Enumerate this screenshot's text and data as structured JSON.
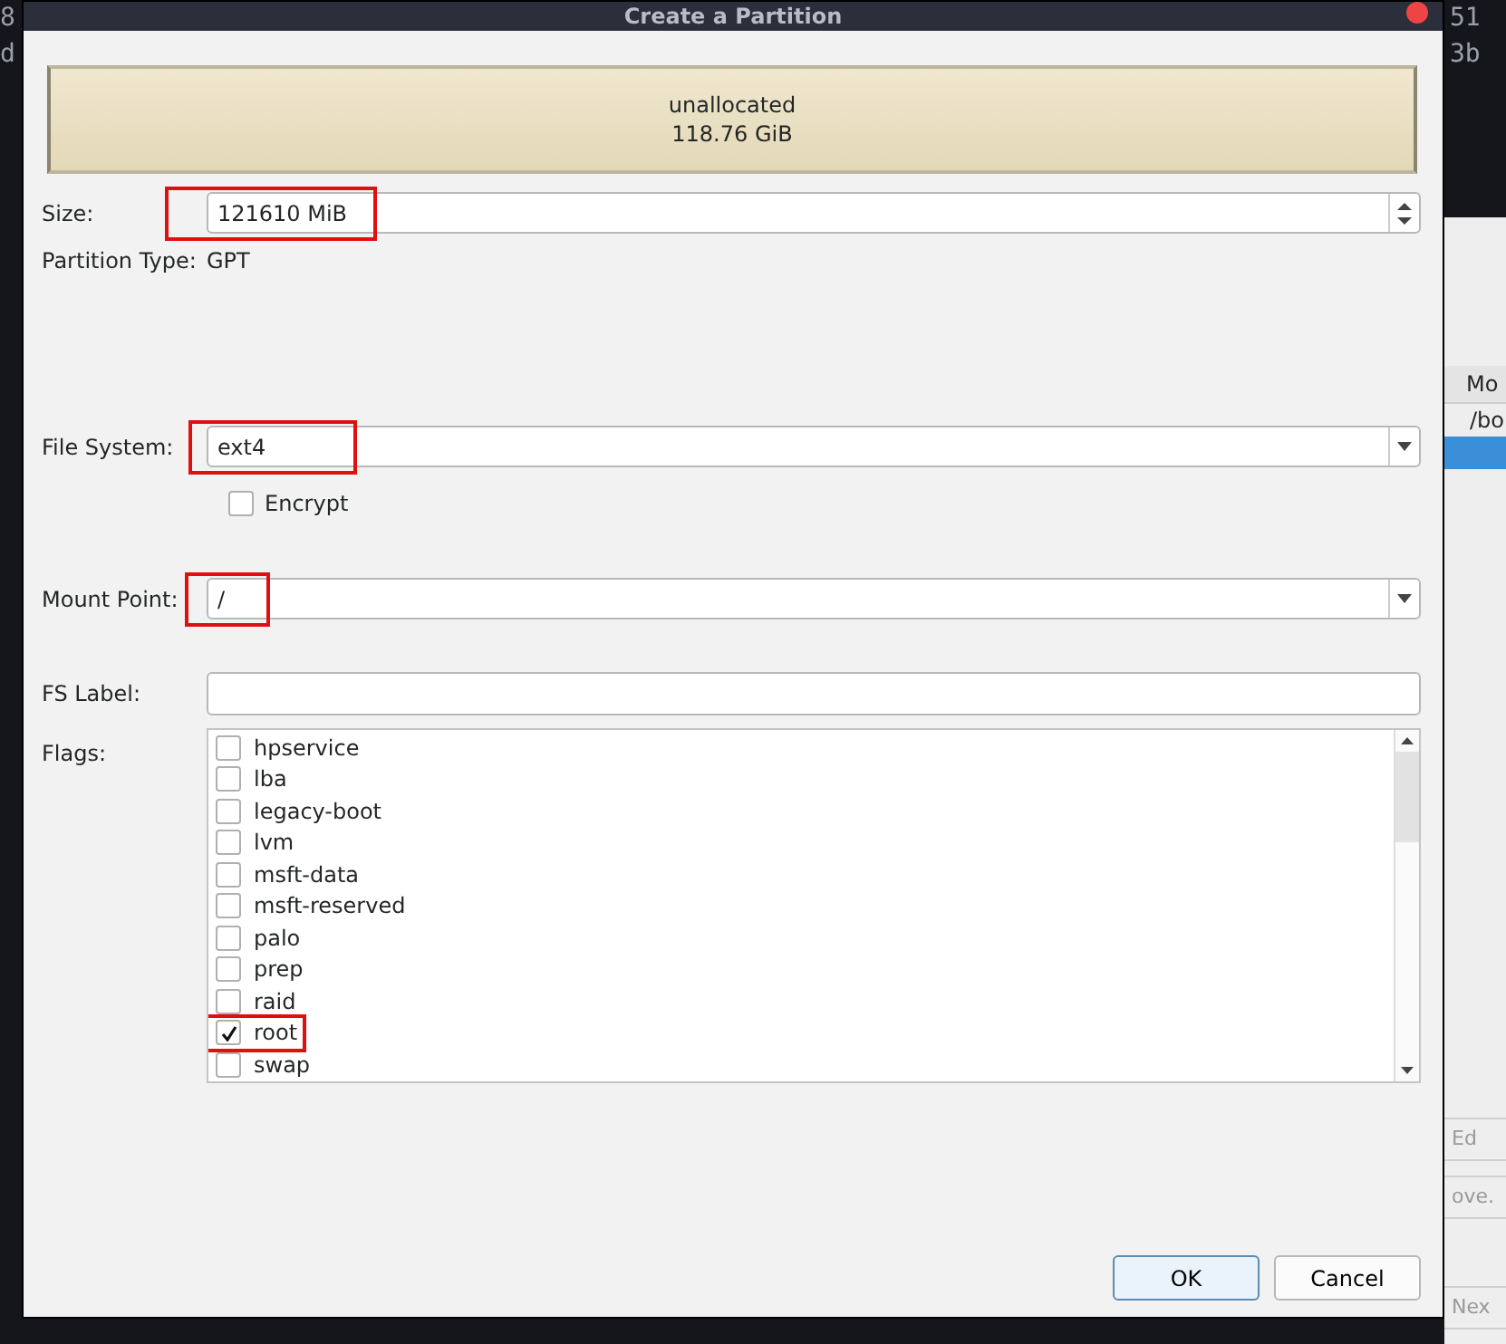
{
  "background_app": {
    "top_texts": [
      "51",
      "3b"
    ],
    "left_texts": [
      "8",
      "d"
    ],
    "table_header": "Mo",
    "table_rows": [
      {
        "text": "/bo",
        "selected": false
      },
      {
        "text": "",
        "selected": true
      }
    ],
    "buttons": [
      "Ed",
      "ove.",
      "Nex"
    ]
  },
  "window": {
    "title": "Create a Partition"
  },
  "partition_bar": {
    "label": "unallocated",
    "size": "118.76 GiB"
  },
  "size": {
    "label": "Size:",
    "value": "121610 MiB",
    "annotated": true
  },
  "partition_type": {
    "label": "Partition Type:",
    "value": "GPT"
  },
  "file_system": {
    "label": "File System:",
    "value": "ext4",
    "annotated": true
  },
  "encrypt": {
    "label": "Encrypt",
    "checked": false
  },
  "mount_point": {
    "label": "Mount Point:",
    "value": "/",
    "annotated": true
  },
  "fs_label": {
    "label": "FS Label:"
  },
  "flags": {
    "label": "Flags:",
    "items": [
      {
        "label": "hpservice",
        "checked": false,
        "annotated": false
      },
      {
        "label": "lba",
        "checked": false,
        "annotated": false
      },
      {
        "label": "legacy-boot",
        "checked": false,
        "annotated": false
      },
      {
        "label": "lvm",
        "checked": false,
        "annotated": false
      },
      {
        "label": "msft-data",
        "checked": false,
        "annotated": false
      },
      {
        "label": "msft-reserved",
        "checked": false,
        "annotated": false
      },
      {
        "label": "palo",
        "checked": false,
        "annotated": false
      },
      {
        "label": "prep",
        "checked": false,
        "annotated": false
      },
      {
        "label": "raid",
        "checked": false,
        "annotated": false
      },
      {
        "label": "root",
        "checked": true,
        "annotated": true
      },
      {
        "label": "swap",
        "checked": false,
        "annotated": false
      }
    ]
  },
  "buttons": [
    {
      "label": "OK",
      "kind": "default"
    },
    {
      "label": "Cancel",
      "kind": "normal"
    }
  ]
}
